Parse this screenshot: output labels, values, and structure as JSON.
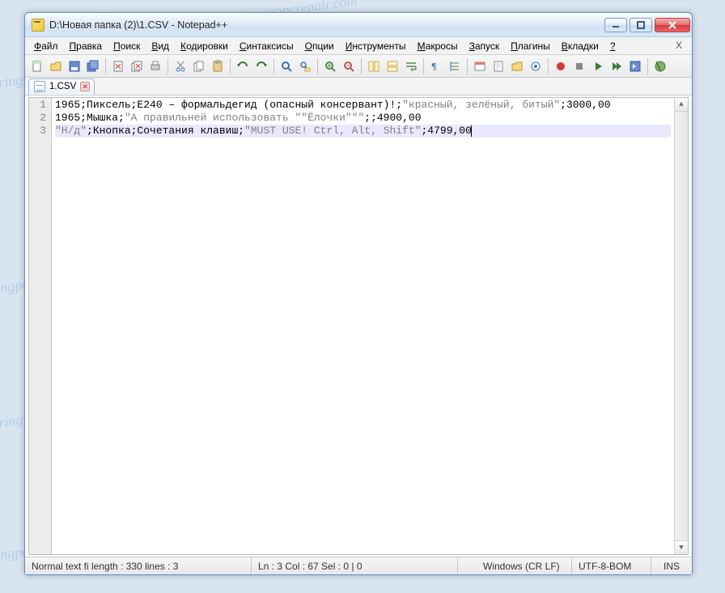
{
  "window": {
    "title": "D:\\Новая папка (2)\\1.CSV - Notepad++"
  },
  "menu": {
    "items": [
      "Файл",
      "Правка",
      "Поиск",
      "Вид",
      "Кодировки",
      "Синтаксисы",
      "Опции",
      "Инструменты",
      "Макросы",
      "Запуск",
      "Плагины",
      "Вкладки",
      "?"
    ],
    "x": "X"
  },
  "toolbar": {
    "icons": [
      "new-file-icon",
      "open-file-icon",
      "save-icon",
      "save-all-icon",
      "sep",
      "close-icon",
      "close-all-icon",
      "print-icon",
      "sep",
      "cut-icon",
      "copy-icon",
      "paste-icon",
      "sep",
      "undo-icon",
      "redo-icon",
      "sep",
      "find-icon",
      "replace-icon",
      "sep",
      "zoom-in-icon",
      "zoom-out-icon",
      "sep",
      "sync-v-icon",
      "sync-h-icon",
      "wrap-icon",
      "sep",
      "show-all-chars-icon",
      "indent-guide-icon",
      "sep",
      "lang-pref-icon",
      "doc-map-icon",
      "folder-icon",
      "monitor-icon",
      "sep",
      "record-macro-icon",
      "stop-macro-icon",
      "play-macro-icon",
      "play-multi-icon",
      "save-macro-icon",
      "sep",
      "spellcheck-icon"
    ]
  },
  "tabs": [
    {
      "label": "1.CSV"
    }
  ],
  "editor": {
    "lines": [
      {
        "n": 1,
        "segments": [
          {
            "t": "1965"
          },
          {
            "t": ";Пиксель;E240 – формальдегид (опасный консервант)!;"
          },
          {
            "t": "\"красный, зелёный, битый\"",
            "cls": "s-str"
          },
          {
            "t": ";3000,00"
          }
        ]
      },
      {
        "n": 2,
        "segments": [
          {
            "t": "1965"
          },
          {
            "t": ";Мышка;"
          },
          {
            "t": "\"А правильней использовать \"\"Ёлочки\"\"\"",
            "cls": "s-str"
          },
          {
            "t": ";;4900,00"
          }
        ]
      },
      {
        "n": 3,
        "current": true,
        "segments": [
          {
            "t": "\"Н/д\"",
            "cls": "s-str"
          },
          {
            "t": ";Кнопка;Сочетания клавиш;"
          },
          {
            "t": "\"MUST USE! Ctrl, Alt, Shift\"",
            "cls": "s-str"
          },
          {
            "t": ";4799,00"
          }
        ]
      }
    ]
  },
  "status": {
    "filetype_length": "Normal text fi  length : 330    lines : 3",
    "position": "Ln : 3    Col : 67    Sel : 0 | 0",
    "eol": "Windows (CR LF)",
    "encoding": "UTF-8-BOM",
    "mode": "INS"
  },
  "watermark": "Soringpcrepair.com"
}
